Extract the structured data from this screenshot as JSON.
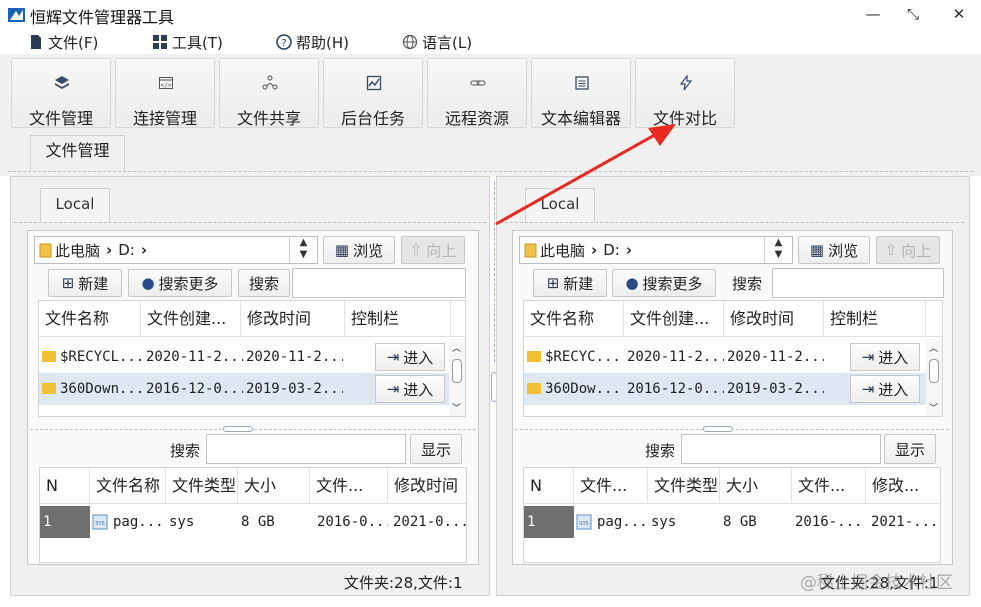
{
  "window": {
    "title": "恒辉文件管理器工具"
  },
  "menu": [
    {
      "label": "文件(F)",
      "icon": "file-icon"
    },
    {
      "label": "工具(T)",
      "icon": "grid-icon"
    },
    {
      "label": "帮助(H)",
      "icon": "help-icon"
    },
    {
      "label": "语言(L)",
      "icon": "globe-icon"
    }
  ],
  "toolbar": [
    {
      "label": "文件管理",
      "icon": "layers-icon"
    },
    {
      "label": "连接管理",
      "icon": "code-window-icon"
    },
    {
      "label": "文件共享",
      "icon": "share-icon"
    },
    {
      "label": "后台任务",
      "icon": "chart-icon"
    },
    {
      "label": "远程资源",
      "icon": "link-icon"
    },
    {
      "label": "文本编辑器",
      "icon": "document-icon"
    },
    {
      "label": "文件对比",
      "icon": "bolt-icon"
    }
  ],
  "doc_tab": "文件管理",
  "panes": [
    {
      "tab": "Local",
      "path": [
        "此电脑",
        "D:"
      ],
      "browse_label": "浏览",
      "up_label": "向上",
      "new_label": "新建",
      "search_more_label": "搜索更多",
      "search_label": "搜索",
      "columns": [
        "文件名称",
        "文件创建...",
        "修改时间",
        "控制栏"
      ],
      "rows": [
        {
          "name": "$RECYCL...",
          "created": "2020-11-2...",
          "modified": "2020-11-2...",
          "action": "进入"
        },
        {
          "name": "360Down...",
          "created": "2016-12-0...",
          "modified": "2019-03-2...",
          "action": "进入"
        }
      ],
      "bottom_search_label": "搜索",
      "show_label": "显示",
      "result_columns": [
        "N",
        "文件名称",
        "文件类型",
        "大小",
        "文件...",
        "修改时间"
      ],
      "result_rows": [
        {
          "n": "1",
          "name": "pag...",
          "type": "sys",
          "size": "8 GB",
          "created": "2016-0...",
          "modified": "2021-0..."
        }
      ],
      "status": "文件夹:28,文件:1"
    },
    {
      "tab": "Local",
      "path": [
        "此电脑",
        "D:"
      ],
      "browse_label": "浏览",
      "up_label": "向上",
      "new_label": "新建",
      "search_more_label": "搜索更多",
      "search_label": "搜索",
      "columns": [
        "文件名称",
        "文件创建...",
        "修改时间",
        "控制栏"
      ],
      "rows": [
        {
          "name": "$RECYC...",
          "created": "2020-11-2...",
          "modified": "2020-11-2...",
          "action": "进入"
        },
        {
          "name": "360Dow...",
          "created": "2016-12-0...",
          "modified": "2019-03-2...",
          "action": "进入"
        }
      ],
      "bottom_search_label": "搜索",
      "show_label": "显示",
      "result_columns": [
        "N",
        "文件...",
        "文件类型",
        "大小",
        "文件...",
        "修改..."
      ],
      "result_rows": [
        {
          "n": "1",
          "name": "pag...",
          "type": "sys",
          "size": "8 GB",
          "created": "2016-...",
          "modified": "2021-..."
        }
      ],
      "status": "文件夹:28,文件:1"
    }
  ],
  "watermark": "@稀土掘金技术社区",
  "colors": {
    "annotation_arrow": "#e8291f",
    "selected_row": "#dde8f3"
  }
}
